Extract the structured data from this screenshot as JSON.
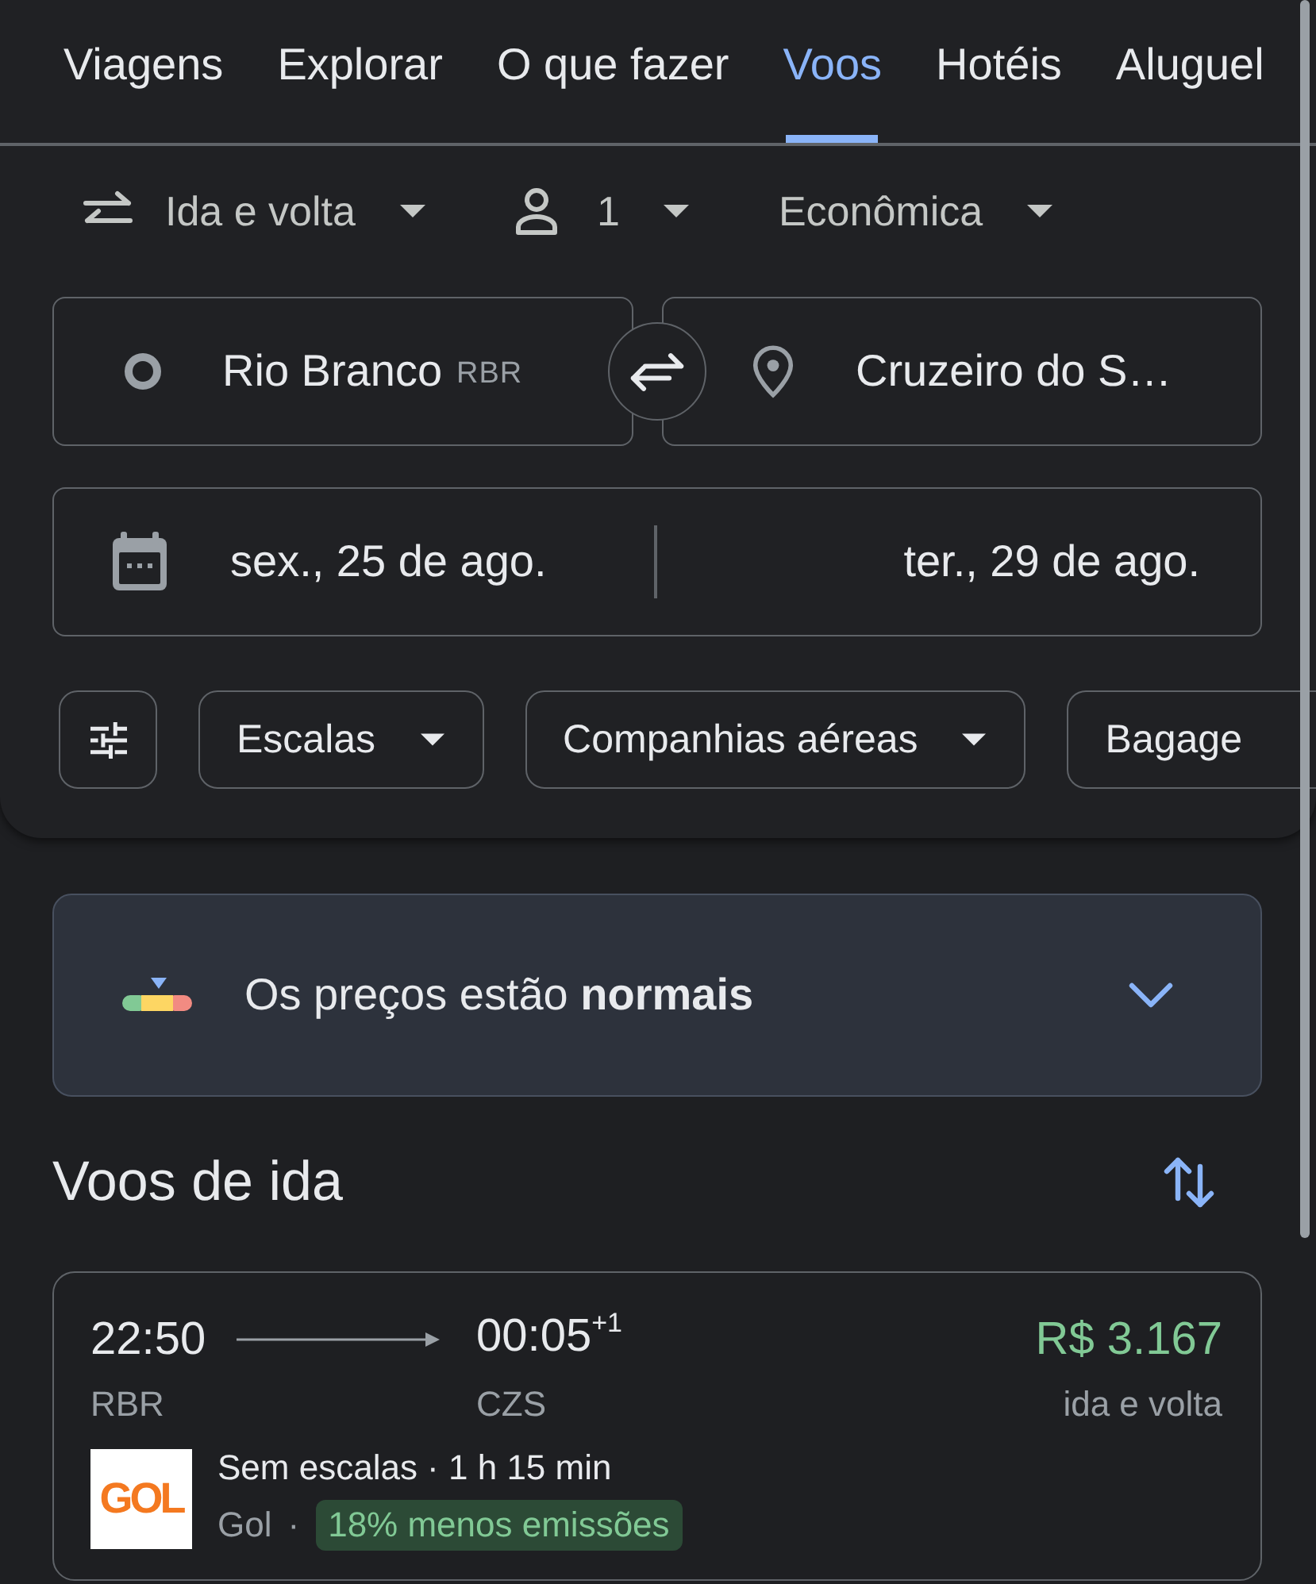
{
  "tabs": [
    {
      "label": "Viagens",
      "selected": false
    },
    {
      "label": "Explorar",
      "selected": false
    },
    {
      "label": "O que fazer",
      "selected": false
    },
    {
      "label": "Voos",
      "selected": true
    },
    {
      "label": "Hotéis",
      "selected": false
    },
    {
      "label": "Aluguel",
      "selected": false
    }
  ],
  "trip_options": [
    {
      "kind": "trip_type",
      "label": "Ida e volta"
    },
    {
      "kind": "passengers",
      "label": "1"
    },
    {
      "kind": "cabin",
      "label": "Econômica"
    }
  ],
  "origin": {
    "city": "Rio Branco",
    "code": "RBR"
  },
  "destination": {
    "city": "Cruzeiro do S…"
  },
  "dates": {
    "departure": "sex., 25 de ago.",
    "return": "ter., 29 de ago."
  },
  "filters": [
    {
      "label": "Escalas"
    },
    {
      "label": "Companhias aéreas"
    },
    {
      "label": "Bagage"
    }
  ],
  "price_insight": {
    "text": "Os preços estão **normais**",
    "expanded": false
  },
  "results": {
    "title": "Voos de ida",
    "flights": [
      {
        "departure_time": "22:50",
        "arrival_time": "00:05$^{+1}$",
        "origin": "RBR",
        "destination": "CZS",
        "price": "R$ 3.167",
        "price_note": "ida e volta",
        "summary": "Sem escalas · 1 h 15 min",
        "logo_text": "GOL",
        "airline": "Gol",
        "separator": "·",
        "emissions": "18% menos emissões"
      }
    ]
  }
}
